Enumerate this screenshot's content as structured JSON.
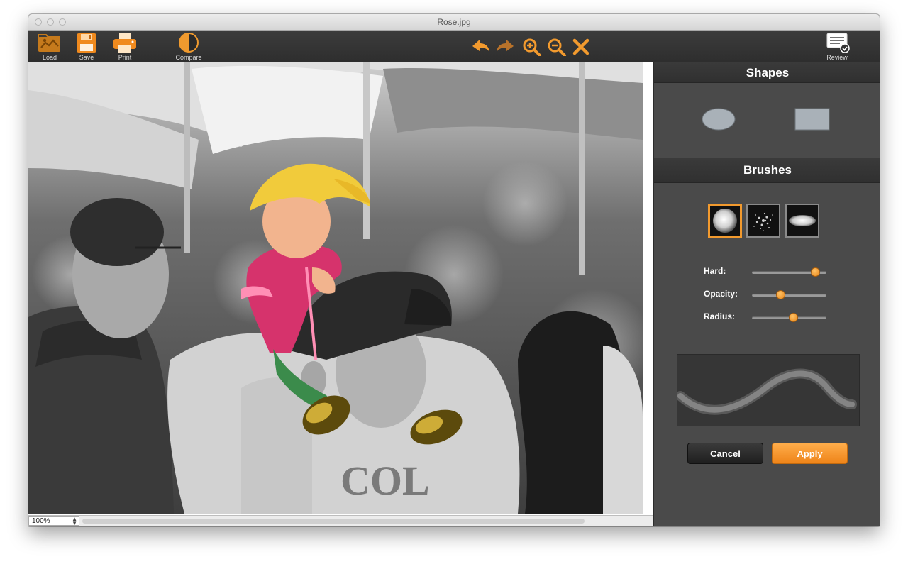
{
  "window": {
    "title": "Rose.jpg"
  },
  "toolbar": {
    "load_label": "Load",
    "save_label": "Save",
    "print_label": "Print",
    "compare_label": "Compare",
    "review_label": "Review",
    "nav_icons": [
      "undo-icon",
      "redo-icon",
      "zoom-in-icon",
      "zoom-out-icon",
      "close-icon"
    ]
  },
  "canvas": {
    "zoom": "100%"
  },
  "panel": {
    "shapes_title": "Shapes",
    "shapes": [
      "ellipse",
      "rectangle"
    ],
    "brushes_title": "Brushes",
    "brushes": [
      "soft-round",
      "scatter",
      "flat-ellipse"
    ],
    "selected_brush": 0,
    "sliders": [
      {
        "label": "Hard:",
        "value": 0.85
      },
      {
        "label": "Opacity:",
        "value": 0.38
      },
      {
        "label": "Radius:",
        "value": 0.55
      }
    ],
    "cancel_label": "Cancel",
    "apply_label": "Apply"
  },
  "colors": {
    "accent": "#f29a2e",
    "toolbar_bg": "#333333",
    "panel_bg": "#4a4a4a"
  }
}
